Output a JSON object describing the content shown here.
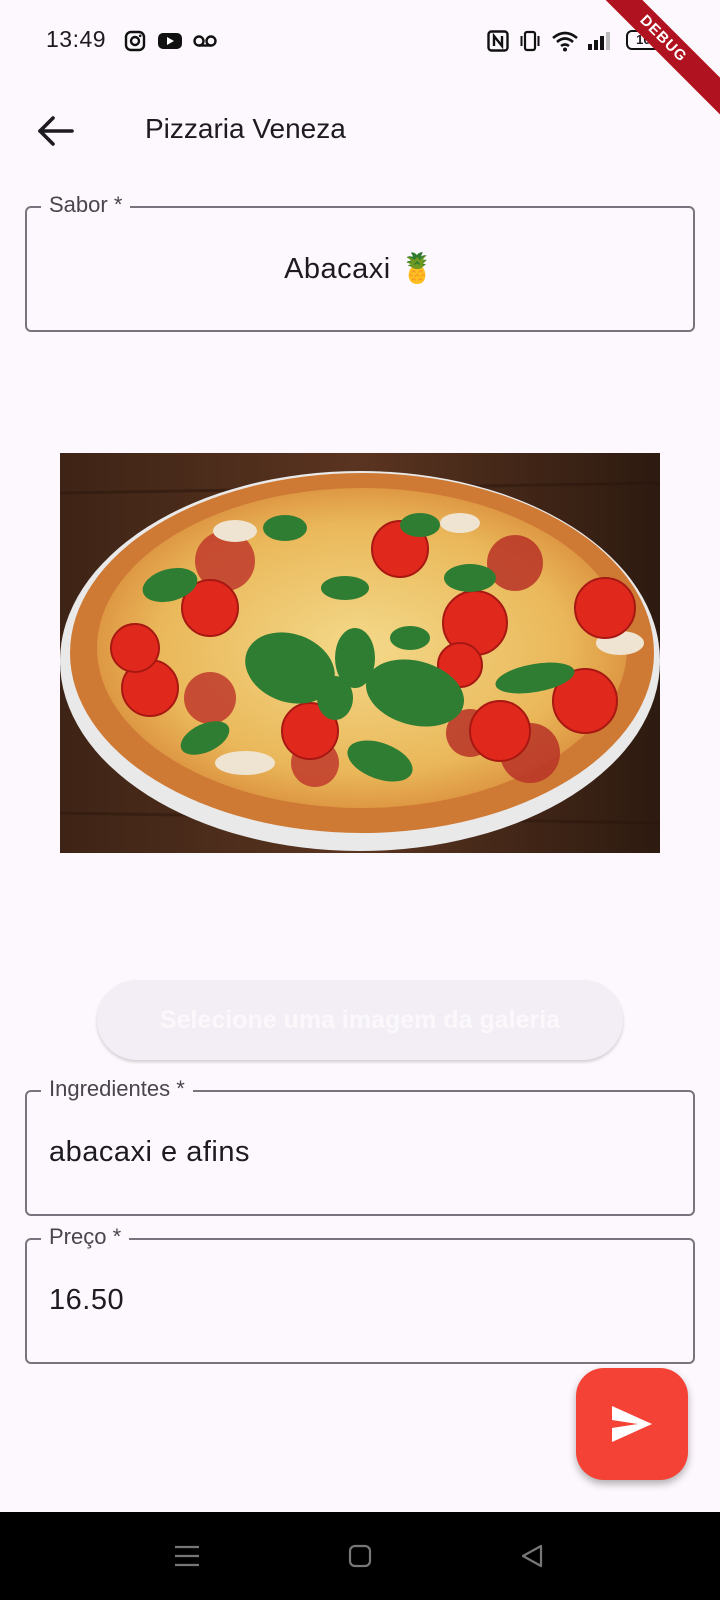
{
  "status_bar": {
    "time": "13:49",
    "battery": "100",
    "debug_banner": "DEBUG",
    "icons": [
      "instagram-icon",
      "youtube-icon",
      "voicemail-icon",
      "nfc-icon",
      "vibrate-icon",
      "wifi-icon",
      "signal-icon",
      "battery-icon"
    ]
  },
  "app_bar": {
    "title": "Pizzaria Veneza"
  },
  "form": {
    "sabor": {
      "label": "Sabor *",
      "value": "Abacaxi 🍍"
    },
    "gallery_button": "Selecione uma imagem da galeria",
    "ingredientes": {
      "label": "Ingredientes *",
      "value": "abacaxi e afins"
    },
    "preco": {
      "label": "Preço *",
      "value": "16.50"
    }
  },
  "colors": {
    "background": "#fdf8fd",
    "fab": "#f44336",
    "outline": "#79747e"
  }
}
